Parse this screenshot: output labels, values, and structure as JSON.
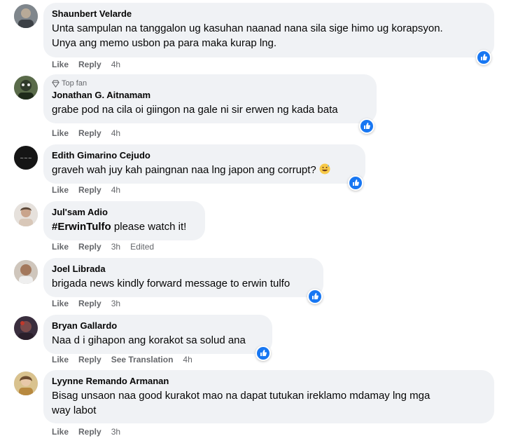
{
  "comments": [
    {
      "author": "Shaunbert Velarde",
      "text_line1": "Unta sampulan na tanggalon ug kasuhan naanad nana sila sige himo ug korapsyon.",
      "text_line2": "Unya ang memo usbon pa para maka kurap lng.",
      "like": "Like",
      "reply": "Reply",
      "time": "4h",
      "reaction_icon": "like-icon"
    },
    {
      "badge": "Top fan",
      "author": "Jonathan G. Aitnamam",
      "text_line1": "grabe pod na cila oi giingon na gale ni sir erwen ng kada bata",
      "like": "Like",
      "reply": "Reply",
      "time": "4h",
      "reaction_icon": "like-icon"
    },
    {
      "author": "Edith Gimarino Cejudo",
      "text_line1": "graveh wah juy kah paingnan naa lng japon ang corrupt?",
      "like": "Like",
      "reply": "Reply",
      "time": "4h",
      "reaction_icon": "like-icon"
    },
    {
      "author": "Jul'sam Adio",
      "hashtag": "#ErwinTulfo",
      "text_line1": " please watch it!",
      "like": "Like",
      "reply": "Reply",
      "time": "3h",
      "edited": "Edited"
    },
    {
      "author": "Joel Librada",
      "text_line1": "brigada news kindly forward message to erwin tulfo",
      "like": "Like",
      "reply": "Reply",
      "time": "3h",
      "reaction_icon": "like-icon"
    },
    {
      "author": "Bryan Gallardo",
      "text_line1": "Naa d i gihapon ang korakot sa solud ana",
      "like": "Like",
      "reply": "Reply",
      "see_translation": "See Translation",
      "time": "4h",
      "reaction_icon": "like-icon"
    },
    {
      "author": "Lyynne Remando Armanan",
      "text_line1": "Bisag unsaon naa good kurakot mao na dapat tutukan ireklamo mdamay lng mga",
      "text_line2": "way labot",
      "like": "Like",
      "reply": "Reply",
      "time": "3h"
    }
  ],
  "colors": {
    "bubble": "#f0f2f5",
    "like_blue": "#1877f2",
    "meta_gray": "#65676b",
    "text": "#050505"
  }
}
